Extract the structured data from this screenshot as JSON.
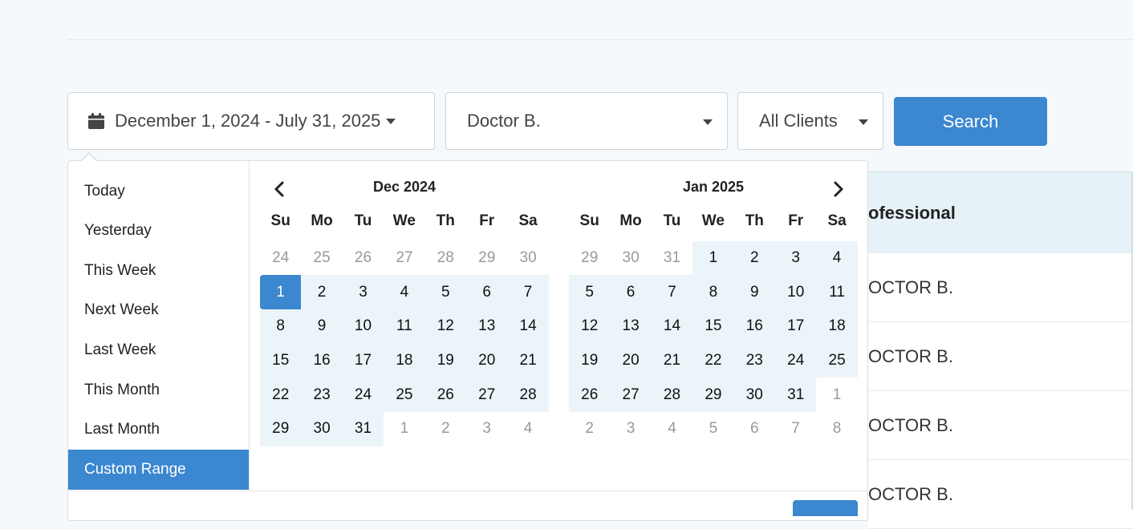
{
  "filters": {
    "date_range": "December 1, 2024 - July 31, 2025",
    "doctor": "Doctor B.",
    "clients": "All Clients",
    "search_label": "Search"
  },
  "table": {
    "header": "ofessional",
    "rows": [
      "OCTOR B.",
      "OCTOR B.",
      "OCTOR B.",
      "OCTOR B."
    ]
  },
  "ranges": [
    "Today",
    "Yesterday",
    "This Week",
    "Next Week",
    "Last Week",
    "This Month",
    "Last Month",
    "Custom Range"
  ],
  "active_range": "Custom Range",
  "weekdays": [
    "Su",
    "Mo",
    "Tu",
    "We",
    "Th",
    "Fr",
    "Sa"
  ],
  "calendars": [
    {
      "title": "Dec 2024",
      "weeks": [
        [
          "24",
          "25",
          "26",
          "27",
          "28",
          "29",
          "30"
        ],
        [
          "1",
          "2",
          "3",
          "4",
          "5",
          "6",
          "7"
        ],
        [
          "8",
          "9",
          "10",
          "11",
          "12",
          "13",
          "14"
        ],
        [
          "15",
          "16",
          "17",
          "18",
          "19",
          "20",
          "21"
        ],
        [
          "22",
          "23",
          "24",
          "25",
          "26",
          "27",
          "28"
        ],
        [
          "29",
          "30",
          "31",
          "1",
          "2",
          "3",
          "4"
        ]
      ],
      "state": [
        [
          "off",
          "off",
          "off",
          "off",
          "off",
          "off",
          "off"
        ],
        [
          "start",
          "in",
          "in",
          "in",
          "in",
          "in",
          "in"
        ],
        [
          "in",
          "in",
          "in",
          "in",
          "in",
          "in",
          "in"
        ],
        [
          "in",
          "in",
          "in",
          "in",
          "in",
          "in",
          "in"
        ],
        [
          "in",
          "in",
          "in",
          "in",
          "in",
          "in",
          "in"
        ],
        [
          "in",
          "in",
          "in",
          "off",
          "off",
          "off",
          "off"
        ]
      ]
    },
    {
      "title": "Jan 2025",
      "weeks": [
        [
          "29",
          "30",
          "31",
          "1",
          "2",
          "3",
          "4"
        ],
        [
          "5",
          "6",
          "7",
          "8",
          "9",
          "10",
          "11"
        ],
        [
          "12",
          "13",
          "14",
          "15",
          "16",
          "17",
          "18"
        ],
        [
          "19",
          "20",
          "21",
          "22",
          "23",
          "24",
          "25"
        ],
        [
          "26",
          "27",
          "28",
          "29",
          "30",
          "31",
          "1"
        ],
        [
          "2",
          "3",
          "4",
          "5",
          "6",
          "7",
          "8"
        ]
      ],
      "state": [
        [
          "off",
          "off",
          "off",
          "in",
          "in",
          "in",
          "in"
        ],
        [
          "in",
          "in",
          "in",
          "in",
          "in",
          "in",
          "in"
        ],
        [
          "in",
          "in",
          "in",
          "in",
          "in",
          "in",
          "in"
        ],
        [
          "in",
          "in",
          "in",
          "in",
          "in",
          "in",
          "in"
        ],
        [
          "in",
          "in",
          "in",
          "in",
          "in",
          "in",
          "off"
        ],
        [
          "off",
          "off",
          "off",
          "off",
          "off",
          "off",
          "off"
        ]
      ]
    }
  ]
}
